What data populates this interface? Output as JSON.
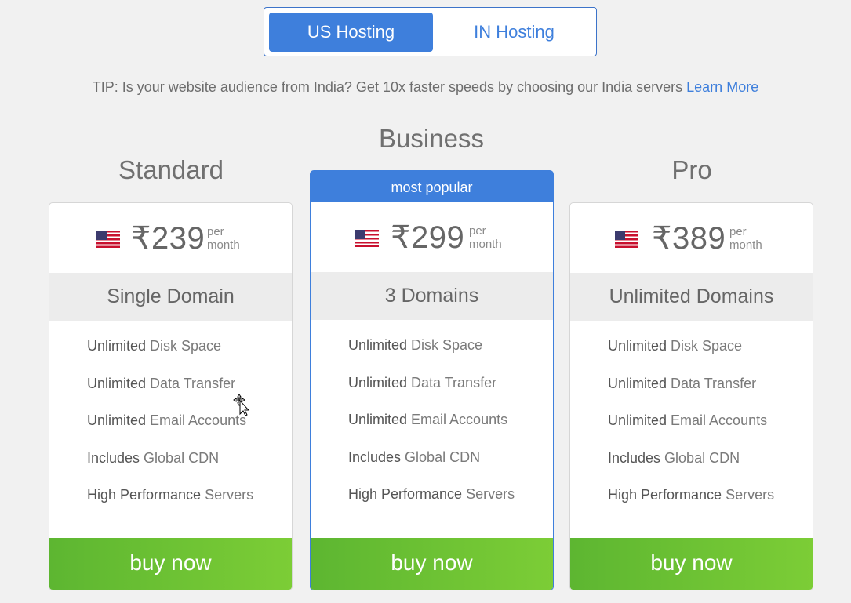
{
  "toggle": {
    "active": "US Hosting",
    "inactive": "IN Hosting"
  },
  "tip": {
    "text": "TIP: Is your website audience from India? Get 10x faster speeds by choosing our India servers ",
    "link": "Learn More"
  },
  "popular_label": "most popular",
  "per_label_line1": "per",
  "per_label_line2": "month",
  "buy_label": "buy now",
  "plans": [
    {
      "name": "Standard",
      "price": "₹239",
      "domains": "Single Domain",
      "features": [
        {
          "bold": "Unlimited",
          "rest": " Disk Space"
        },
        {
          "bold": "Unlimited",
          "rest": " Data Transfer"
        },
        {
          "bold": "Unlimited",
          "rest": " Email Accounts"
        },
        {
          "bold": "Includes",
          "rest": " Global CDN"
        },
        {
          "bold": "High Performance",
          "rest": " Servers"
        }
      ]
    },
    {
      "name": "Business",
      "price": "₹299",
      "domains": "3 Domains",
      "features": [
        {
          "bold": "Unlimited",
          "rest": " Disk Space"
        },
        {
          "bold": "Unlimited",
          "rest": " Data Transfer"
        },
        {
          "bold": "Unlimited",
          "rest": " Email Accounts"
        },
        {
          "bold": "Includes",
          "rest": " Global CDN"
        },
        {
          "bold": "High Performance",
          "rest": " Servers"
        }
      ]
    },
    {
      "name": "Pro",
      "price": "₹389",
      "domains": "Unlimited Domains",
      "features": [
        {
          "bold": "Unlimited",
          "rest": " Disk Space"
        },
        {
          "bold": "Unlimited",
          "rest": " Data Transfer"
        },
        {
          "bold": "Unlimited",
          "rest": " Email Accounts"
        },
        {
          "bold": "Includes",
          "rest": " Global CDN"
        },
        {
          "bold": "High Performance",
          "rest": " Servers"
        }
      ]
    }
  ],
  "colors": {
    "accent": "#3e7fdc",
    "buy_start": "#5db631",
    "buy_end": "#7ccd36",
    "domain_band": "#ececec"
  },
  "icons": {
    "flag": "us-flag-icon",
    "cursor": "move-cursor-icon"
  }
}
